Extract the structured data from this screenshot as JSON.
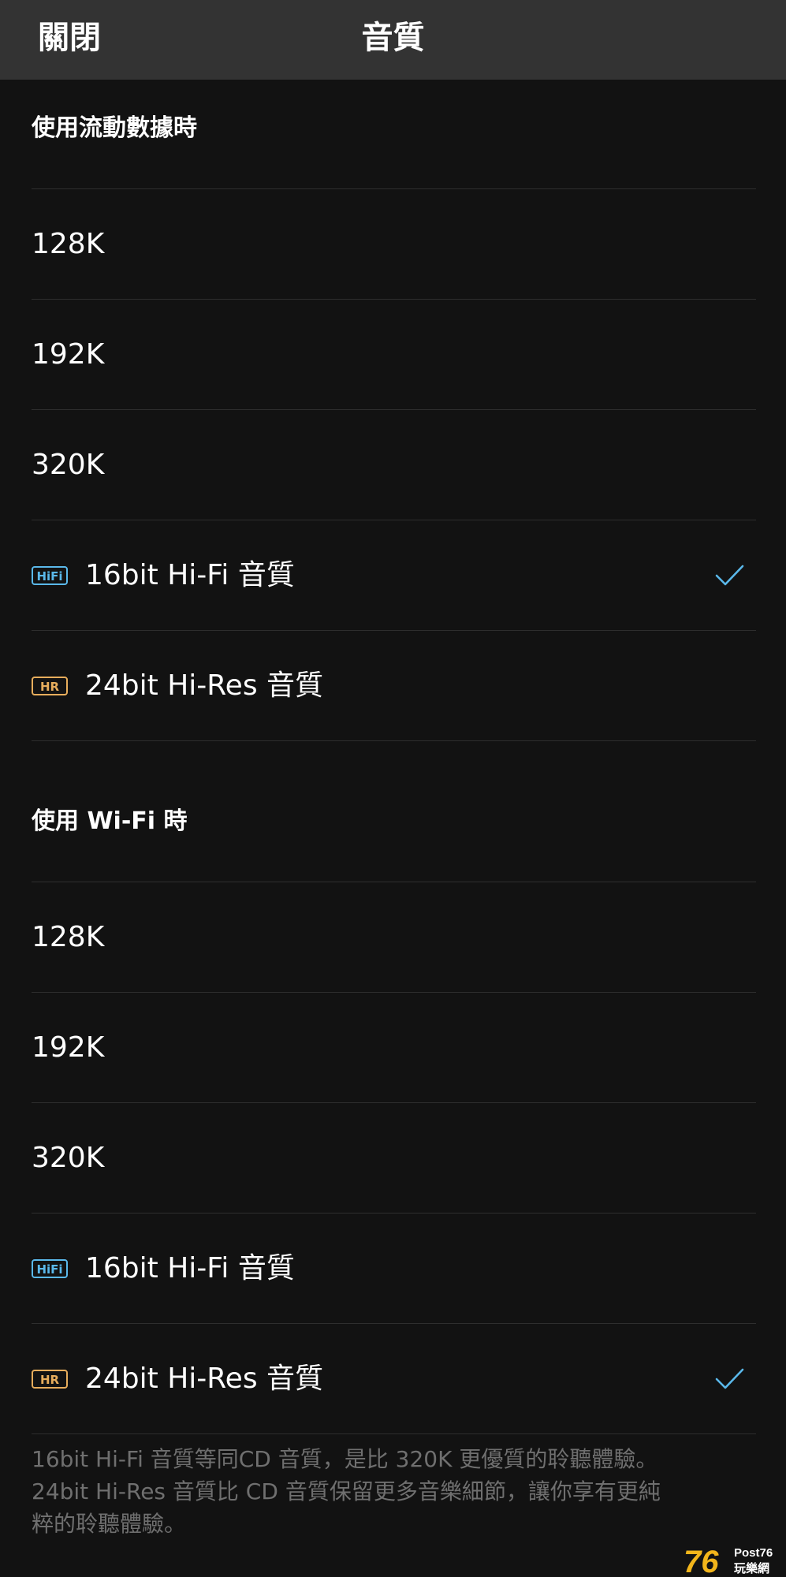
{
  "header": {
    "close_label": "關閉",
    "title": "音質"
  },
  "sections": [
    {
      "title": "使用流動數據時",
      "options": [
        {
          "label": "128K",
          "badge": "",
          "selected": false
        },
        {
          "label": "192K",
          "badge": "",
          "selected": false
        },
        {
          "label": "320K",
          "badge": "",
          "selected": false
        },
        {
          "label": "16bit Hi-Fi 音質",
          "badge": "HiFi",
          "selected": true
        },
        {
          "label": "24bit Hi-Res 音質",
          "badge": "HR",
          "selected": false
        }
      ]
    },
    {
      "title": "使用 Wi-Fi 時",
      "options": [
        {
          "label": "128K",
          "badge": "",
          "selected": false
        },
        {
          "label": "192K",
          "badge": "",
          "selected": false
        },
        {
          "label": "320K",
          "badge": "",
          "selected": false
        },
        {
          "label": "16bit Hi-Fi 音質",
          "badge": "HiFi",
          "selected": false
        },
        {
          "label": "24bit Hi-Res 音質",
          "badge": "HR",
          "selected": true
        }
      ]
    }
  ],
  "footnote": {
    "line1": "16bit Hi-Fi 音質等同CD 音質，是比 320K 更優質的聆聽體驗。",
    "line2": "24bit Hi-Res 音質比 CD 音質保留更多音樂細節，讓你享有更純",
    "line3": "粹的聆聽體驗。"
  },
  "watermark": {
    "number": "76",
    "brand": "Post76",
    "subtitle": "玩樂網"
  },
  "colors": {
    "background": "#121212",
    "header_bg": "#333333",
    "accent_check": "#5ab8ea",
    "hifi_badge": "#5ab8ea",
    "hr_badge": "#e7ad5c",
    "divider": "#2e2e2e",
    "footnote_text": "#6f6f6f"
  },
  "icons": {
    "selected": "check-icon",
    "hifi": "hifi-badge-icon",
    "hr": "hr-badge-icon"
  }
}
